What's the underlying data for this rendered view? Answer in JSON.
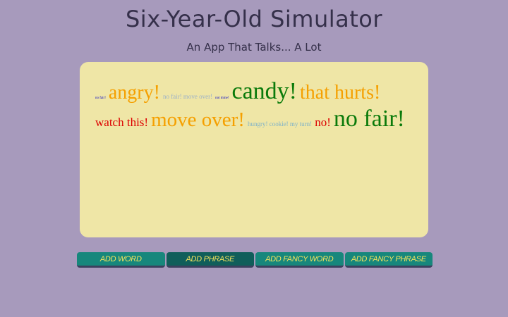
{
  "header": {
    "title": "Six-Year-Old Simulator",
    "subtitle": "An App That Talks... A Lot"
  },
  "board": {
    "background": "#efe6a6",
    "phrases": [
      {
        "text": "no fair!",
        "color": "#0000cc",
        "size": 5
      },
      {
        "text": "angry!",
        "color": "#f5a000",
        "size": 28
      },
      {
        "text": "no fair! move over!",
        "color": "#9ab0c8",
        "size": 9
      },
      {
        "text": "not mine!",
        "color": "#0000cc",
        "size": 5
      },
      {
        "text": "candy!",
        "color": "#0a7a0a",
        "size": 34
      },
      {
        "text": "that hurts!",
        "color": "#f5a000",
        "size": 28
      },
      {
        "text": "watch this!",
        "color": "#dd0000",
        "size": 17
      },
      {
        "text": "move over!",
        "color": "#f5a000",
        "size": 29
      },
      {
        "text": "hungry! cookie! my turn!",
        "color": "#7db1c8",
        "size": 9
      },
      {
        "text": "no!",
        "color": "#dd0000",
        "size": 17
      },
      {
        "text": "no fair!",
        "color": "#0a7a0a",
        "size": 34
      }
    ]
  },
  "buttons": [
    {
      "label": "ADD WORD",
      "active": false
    },
    {
      "label": "ADD PHRASE",
      "active": true
    },
    {
      "label": "ADD FANCY WORD",
      "active": false
    },
    {
      "label": "ADD FANCY PHRASE",
      "active": false
    }
  ],
  "colors": {
    "page_background": "#a79abc",
    "button_background": "#17877c",
    "button_active_background": "#105e5a",
    "button_text": "#f6e45c"
  }
}
